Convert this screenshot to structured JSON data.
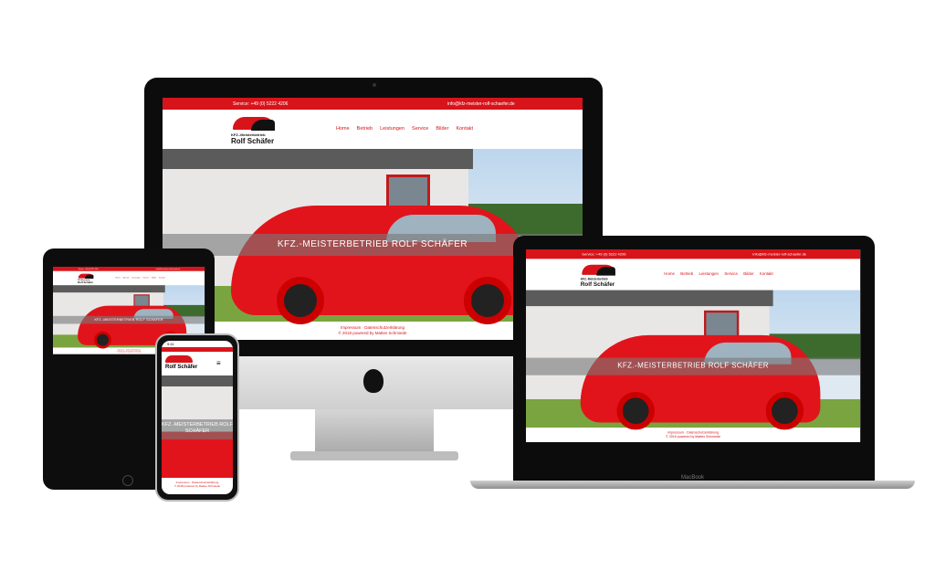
{
  "site": {
    "service": "Service: +49 (0) 5222 4206",
    "email": "info@kfz-meister-rolf-schaefer.de",
    "logo_line1": "KFZ.-Meisterbetrieb",
    "logo_line2": "Rolf Schäfer",
    "nav": [
      "Home",
      "Betrieb",
      "Leistungen",
      "Service",
      "Bilder",
      "Kontakt"
    ],
    "hero_title": "KFZ.-MEISTERBETRIEB ROLF SCHÄFER",
    "footer_links": "Impressum · Datenschutzerklärung",
    "footer_copy": "© 2018 powered by Mattes Schmiede"
  },
  "laptop_label": "MacBook",
  "phone": {
    "time": "9:41",
    "menu_icon": "hamburger-icon"
  },
  "colors": {
    "brand": "#d7141a"
  }
}
